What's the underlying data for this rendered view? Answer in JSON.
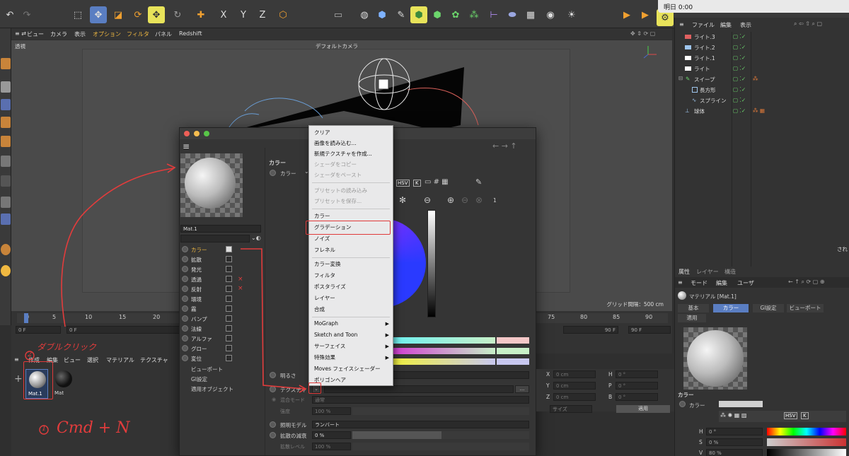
{
  "notification": {
    "text": "明日 0:00"
  },
  "viewport_menu": {
    "items": [
      "ビュー",
      "カメラ",
      "表示",
      "オプション",
      "フィルタ",
      "パネル",
      "Redshift"
    ],
    "label_perspective": "透視",
    "camera": "デフォルトカメラ",
    "grid_info": "グリッド間隔：500 cm"
  },
  "timeline": {
    "ticks": [
      "0",
      "5",
      "10",
      "15",
      "20",
      "75",
      "80",
      "85",
      "90"
    ],
    "start_field": "0 F",
    "current_field": "0 F",
    "end_field": "90 F",
    "end_field2": "90 F"
  },
  "material_manager": {
    "menu": [
      "作成",
      "編集",
      "ビュー",
      "選択",
      "マテリアル",
      "テクスチャ"
    ],
    "materials": [
      "Mat.1",
      "Mat"
    ]
  },
  "object_manager": {
    "menu": [
      "ファイル",
      "編集",
      "表示"
    ],
    "objects": [
      "ライト.3",
      "ライト.2",
      "ライト.1",
      "ライト",
      "スイープ",
      "長方形",
      "スプライン",
      "球体"
    ]
  },
  "attribute_manager": {
    "tabs_top": [
      "属性",
      "レイヤー",
      "構造"
    ],
    "menu": [
      "モード",
      "編集",
      "ユーザ"
    ],
    "material_name": "マテリアル [Mat.1]",
    "tabs": [
      "基本",
      "カラー",
      "GI設定",
      "ビューポート",
      "適用"
    ],
    "section": "カラー",
    "color_label": "カラー",
    "hsv": [
      {
        "label": "H",
        "value": "0 °"
      },
      {
        "label": "S",
        "value": "0 %"
      },
      {
        "label": "V",
        "value": "80 %"
      }
    ],
    "side_text": "され"
  },
  "material_editor": {
    "name": "Mat.1",
    "channels": [
      "カラー",
      "拡散",
      "発光",
      "透過",
      "反射",
      "環境",
      "霧",
      "バンプ",
      "法線",
      "アルファ",
      "グロー",
      "変位"
    ],
    "channel_checked": [
      true,
      false,
      false,
      false,
      false,
      false,
      false,
      false,
      false,
      false,
      false,
      false
    ],
    "extra_items": [
      "ビューポート",
      "GI設定",
      "適用オブジェクト"
    ],
    "section_title": "カラー",
    "color_label": "カラー",
    "color_value": "1",
    "brightness_label": "明るさ",
    "texture_label": "テクスチャ",
    "blend_mode_label": "混合モード",
    "blend_mode_value": "通常",
    "strength_label": "強度",
    "strength_value": "100 %",
    "lighting_model_label": "照明モデル",
    "lighting_model_value": "ランバート",
    "diffuse_falloff_label": "拡散の減衰",
    "diffuse_falloff_value": "0 %",
    "diffuse_level_label": "拡散レベル",
    "diffuse_level_value": "100 %",
    "coord_fields": [
      {
        "label": "X",
        "value": "0 cm"
      },
      {
        "label": "Y",
        "value": "0 cm"
      },
      {
        "label": "Z",
        "value": "0 cm"
      },
      {
        "label": "H",
        "value": "0 °"
      },
      {
        "label": "P",
        "value": "0 °"
      },
      {
        "label": "B",
        "value": "0 °"
      }
    ],
    "size_label": "サイズ",
    "apply_button": "適用",
    "color_modes": [
      "HSV",
      "K"
    ]
  },
  "popup_menu": {
    "items": [
      {
        "label": "クリア",
        "enabled": true
      },
      {
        "label": "画像を読み込む...",
        "enabled": true
      },
      {
        "label": "新規テクスチャを作成...",
        "enabled": true
      },
      {
        "label": "シェーダをコピー",
        "enabled": false
      },
      {
        "label": "シェーダをペースト",
        "enabled": false
      },
      {
        "label": "プリセットの読み込み",
        "enabled": false
      },
      {
        "label": "プリセットを保存...",
        "enabled": false
      },
      {
        "label": "カラー",
        "enabled": true
      },
      {
        "label": "グラデーション",
        "enabled": true
      },
      {
        "label": "ノイズ",
        "enabled": true
      },
      {
        "label": "フレネル",
        "enabled": true
      },
      {
        "label": "カラー変換",
        "enabled": true
      },
      {
        "label": "フィルタ",
        "enabled": true
      },
      {
        "label": "ポスタライズ",
        "enabled": true
      },
      {
        "label": "レイヤー",
        "enabled": true
      },
      {
        "label": "合成",
        "enabled": true
      },
      {
        "label": "MoGraph",
        "enabled": true
      },
      {
        "label": "Sketch and Toon",
        "enabled": true
      },
      {
        "label": "サーフェイス",
        "enabled": true
      },
      {
        "label": "特殊効果",
        "enabled": true
      },
      {
        "label": "Moves フェイスシェーダー",
        "enabled": true
      },
      {
        "label": "ポリゴンヘア",
        "enabled": true
      }
    ]
  },
  "annotations": {
    "double_click": "ダブルクリック",
    "step1": "Cmd + N",
    "step1_num": "1",
    "step2_num": "2"
  },
  "colors": {
    "highlight_yellow": "#e8e35a",
    "accent_orange": "#f1b941",
    "annotation_red": "#e23c3c",
    "tab_active": "#5a7ec2"
  }
}
